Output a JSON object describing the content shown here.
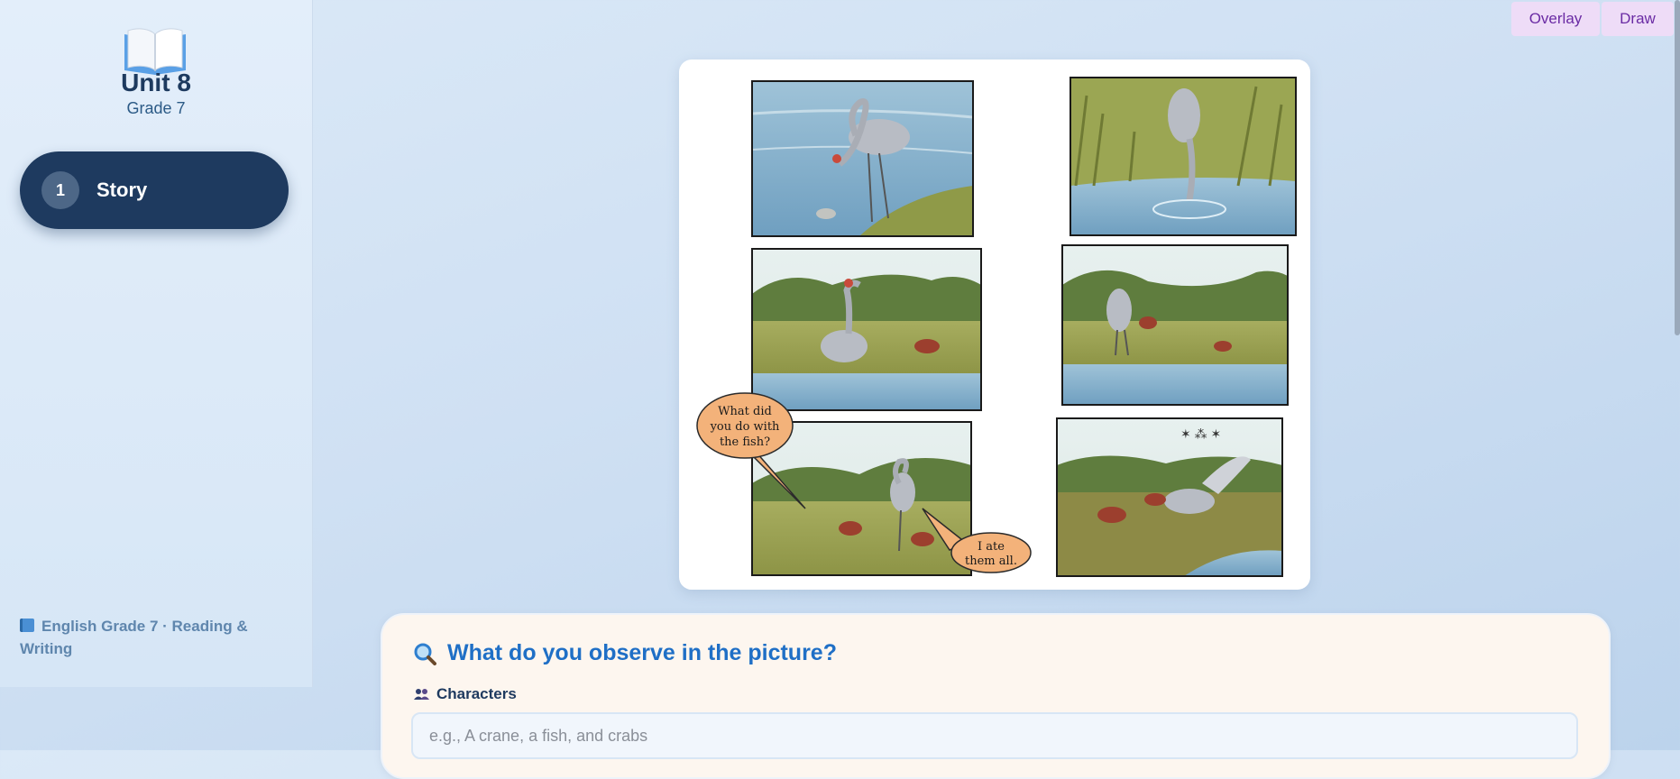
{
  "sidebar": {
    "logo_icon": "open-book-icon",
    "unit_title": "Unit 8",
    "grade": "Grade 7",
    "nav": [
      {
        "number": "1",
        "label": "Story",
        "active": true
      }
    ],
    "footer": "English Grade 7 · Reading & Writing",
    "footer_icon": "blue-book-icon"
  },
  "toolbar": {
    "overlay_label": "Overlay",
    "draw_label": "Draw"
  },
  "picture": {
    "panels": 6,
    "speech_bubble_1": [
      "What did",
      "you do with",
      "the fish?"
    ],
    "speech_bubble_2": [
      "I ate",
      "them all."
    ]
  },
  "question": {
    "icon": "magnifier-icon",
    "title": "What do you observe in the picture?",
    "characters_icon": "people-icon",
    "characters_label": "Characters",
    "characters_placeholder": "e.g., A crane, a fish, and crabs",
    "characters_value": ""
  },
  "colors": {
    "sidebar_active": "#1e3a5f",
    "title_blue": "#1f6fc6",
    "toggle_bg": "#eedcf7",
    "toggle_text": "#6a2ba4"
  }
}
